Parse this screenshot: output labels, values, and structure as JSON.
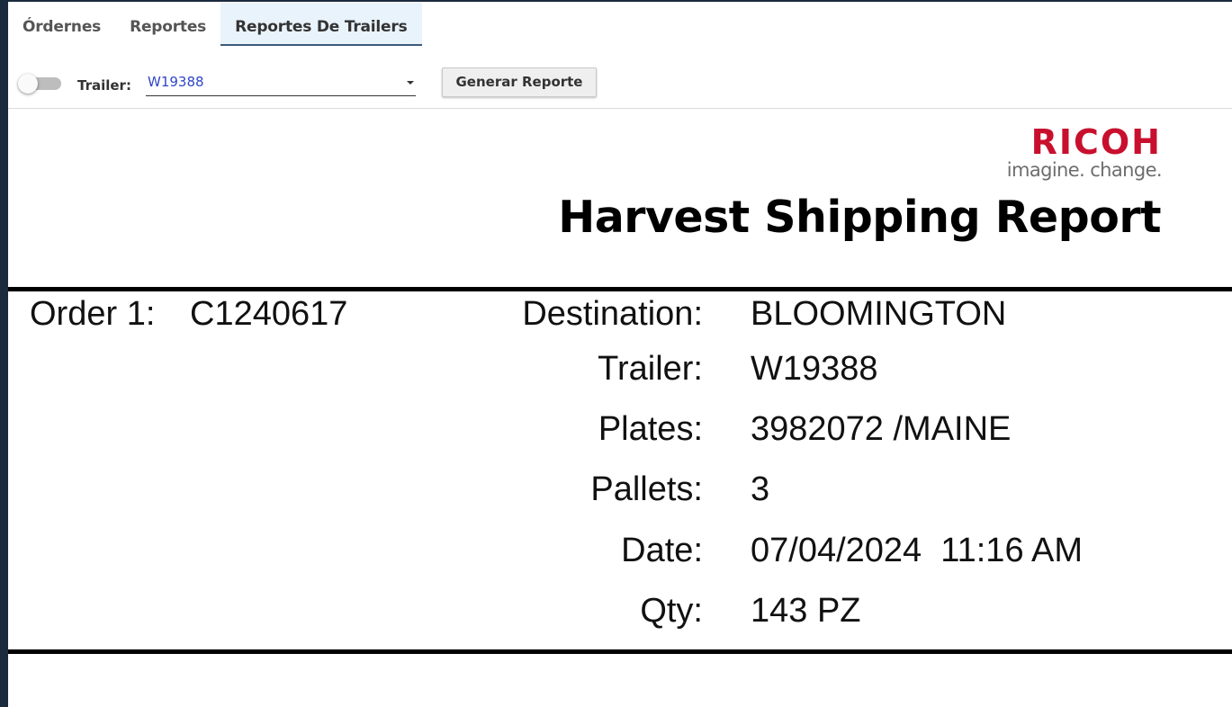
{
  "tabs": [
    {
      "label": "Órdernes",
      "active": false
    },
    {
      "label": "Reportes",
      "active": false
    },
    {
      "label": "Reportes De Trailers",
      "active": true
    }
  ],
  "toolbar": {
    "toggle_on": false,
    "trailer_label": "Trailer:",
    "trailer_selected": "W19388",
    "generate_button": "Generar Reporte"
  },
  "report": {
    "logo": {
      "brand": "RICOH",
      "tagline": "imagine. change."
    },
    "brand_color": "#c8102e",
    "title": "Harvest Shipping Report",
    "order_label": "Order 1:",
    "order_number": "C1240617",
    "fields": [
      {
        "label": "Destination:",
        "value": "BLOOMINGTON"
      },
      {
        "label": "Trailer:",
        "value": "W19388"
      },
      {
        "label": "Plates:",
        "value": "3982072 /MAINE"
      },
      {
        "label": "Pallets:",
        "value": "3"
      },
      {
        "label": "Date:",
        "value": "07/04/2024  11:16 AM"
      },
      {
        "label": "Qty:",
        "value": "143 PZ"
      }
    ]
  }
}
